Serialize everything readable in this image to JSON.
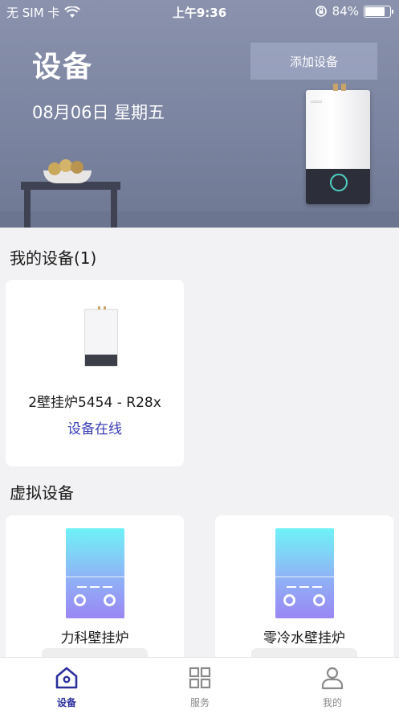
{
  "status_bar": {
    "carrier": "无 SIM 卡",
    "time": "上午9:36",
    "battery": "84%",
    "battery_level": 0.84
  },
  "header": {
    "title": "设备",
    "date": "08月06日 星期五",
    "add_button": "添加设备"
  },
  "my_devices": {
    "title": "我的设备(1)",
    "items": [
      {
        "name": "2壁挂炉5454 - R28x",
        "status": "设备在线"
      }
    ]
  },
  "virtual_devices": {
    "title": "虚拟设备",
    "items": [
      {
        "name": "力科壁挂炉"
      },
      {
        "name": "零冷水壁挂炉"
      }
    ]
  },
  "tabbar": {
    "items": [
      {
        "label": "设备",
        "icon": "home-icon",
        "active": true
      },
      {
        "label": "服务",
        "icon": "grid-icon",
        "active": false
      },
      {
        "label": "我的",
        "icon": "user-icon",
        "active": false
      }
    ]
  },
  "colors": {
    "accent": "#2a2f9c",
    "online_status": "#3a3db6",
    "hero_bg": "#7a839f"
  }
}
